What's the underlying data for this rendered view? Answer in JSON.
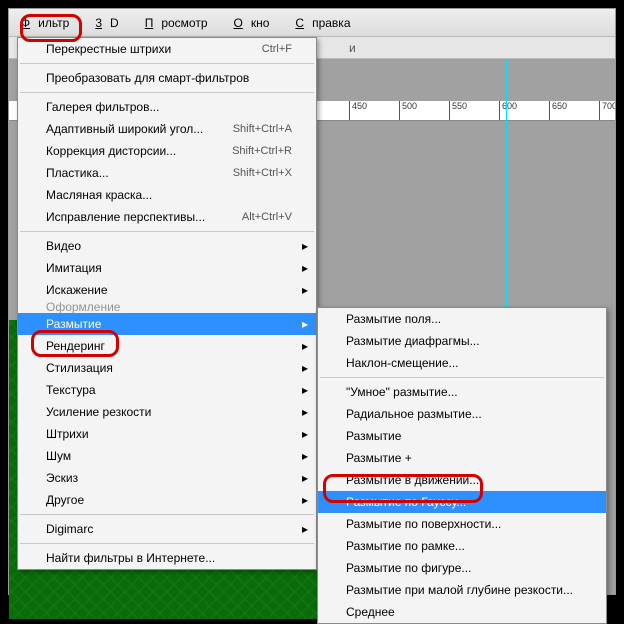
{
  "menubar": {
    "filter": {
      "text": "Фильтр",
      "u": "Ф"
    },
    "three_d": {
      "text": "3D",
      "u": "3"
    },
    "view": {
      "text": "Просмотр",
      "u": "П"
    },
    "window": {
      "text": "Окно",
      "u": "О"
    },
    "help": {
      "text": "Справка",
      "u": "С"
    }
  },
  "toolbar_stub": "и",
  "ruler_ticks": [
    "450",
    "500",
    "550",
    "600",
    "650",
    "700"
  ],
  "filter_menu": {
    "last": {
      "label": "Перекрестные штрихи",
      "shortcut": "Ctrl+F"
    },
    "convert_smart": "Преобразовать для смарт-фильтров",
    "gallery": "Галерея фильтров...",
    "adaptive": {
      "label": "Адаптивный широкий угол...",
      "shortcut": "Shift+Ctrl+A"
    },
    "lens": {
      "label": "Коррекция дисторсии...",
      "shortcut": "Shift+Ctrl+R"
    },
    "liquify": {
      "label": "Пластика...",
      "shortcut": "Shift+Ctrl+X"
    },
    "oil": "Масляная краска...",
    "vanishing": {
      "label": "Исправление перспективы...",
      "shortcut": "Alt+Ctrl+V"
    },
    "cats": {
      "video": "Видео",
      "imitation": "Имитация",
      "distort": "Искажение",
      "truncated": "Оформление",
      "blur": "Размытие",
      "render": "Рендеринг",
      "stylize": "Стилизация",
      "texture": "Текстура",
      "sharpen": "Усиление резкости",
      "strokes": "Штрихи",
      "noise": "Шум",
      "sketch": "Эскиз",
      "other": "Другое"
    },
    "digimarc": "Digimarc",
    "browse": "Найти фильтры в Интернете..."
  },
  "blur_submenu": {
    "field": "Размытие поля...",
    "iris": "Размытие диафрагмы...",
    "tiltshift": "Наклон-смещение...",
    "smart": "\"Умное\" размытие...",
    "radial": "Радиальное размытие...",
    "blur": "Размытие",
    "more": "Размытие +",
    "motion": "Размытие в движении...",
    "gaussian": "Размытие по Гауссу...",
    "surface": "Размытие по поверхности...",
    "box": "Размытие по рамке...",
    "shape": "Размытие по фигуре...",
    "lens": "Размытие при малой глубине резкости...",
    "average": "Среднее"
  }
}
